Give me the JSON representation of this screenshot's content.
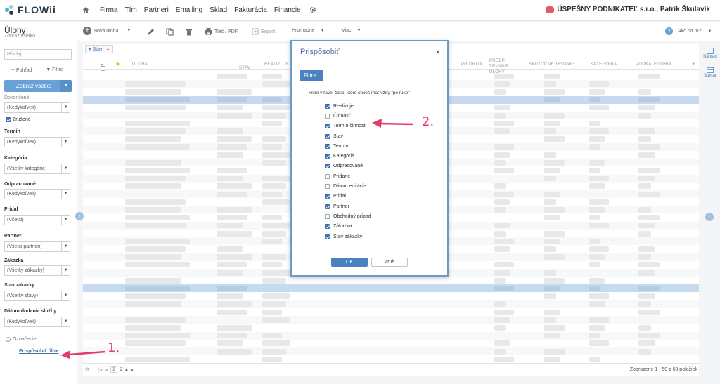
{
  "app": {
    "logo_text": "FLOWii"
  },
  "nav": {
    "items": [
      "Firma",
      "Tím",
      "Partneri",
      "Emailing",
      "Sklad",
      "Fakturácia",
      "Financie"
    ]
  },
  "company": {
    "label": "ÚSPEŠNÝ PODNIKATEĽ s.r.o., Patrik Škulavík"
  },
  "sidebar": {
    "title": "Úlohy",
    "subtitle": "Zobraz všetko",
    "search_placeholder": "Hľadaj...",
    "tab_view": "Pohľad",
    "tab_filters": "Filtre",
    "primary_button": "Zobraz všetko",
    "filters": [
      {
        "label": "Dokončené",
        "value": "(Kedykoľvek)"
      },
      {
        "label": "Termín",
        "value": "(Kedykoľvek)"
      },
      {
        "label": "Kategória",
        "value": "(Všetky kategórie)"
      },
      {
        "label": "Odpracované",
        "value": "(Kedykoľvek)"
      },
      {
        "label": "Pridal",
        "value": "(Všetci)"
      },
      {
        "label": "Partner",
        "value": "(Všetci partneri)"
      },
      {
        "label": "Zákazka",
        "value": "(Všetky zákazky)"
      },
      {
        "label": "Stav zákazky",
        "value": "(Všetky stavy)"
      },
      {
        "label": "Dátum dodania služby",
        "value": "(Kedykoľvek)"
      }
    ],
    "checkbox_zrusene": "Zrušené",
    "radio_oznacenie": "Označenie",
    "customize_link": "Prispôsobiť filtre"
  },
  "toolbar": {
    "new_task": "Nová úloha",
    "print": "Tlač / PDF",
    "export": "Export",
    "bulk": "Hromadne",
    "more": "Viac",
    "help": "Ako na to?"
  },
  "grid": {
    "tag": "Stav",
    "columns": [
      "ÚLOHA",
      "STAV",
      "REALIZUJE",
      "PRIORITA",
      "PREDP. TRVANIE ÚLOHY",
      "SKUTOČNÉ TRVANIE",
      "KATEGÓRIA",
      "PODKATEGÓRIA"
    ],
    "pages": [
      "1",
      "2"
    ],
    "summary": "Zobrazené 1 - 50 z 60 položiek"
  },
  "rail": {
    "preview": "Náhľad",
    "summary": "Sumár"
  },
  "modal": {
    "title": "Prispôsobiť",
    "close": "×",
    "tab": "Filtre",
    "description": "Filtre v ľavej časti, ktoré chceš mať vždy \"po ruke\"",
    "options": [
      {
        "label": "Realizuje",
        "checked": true
      },
      {
        "label": "Činnosť",
        "checked": false
      },
      {
        "label": "Termín činnosti",
        "checked": true
      },
      {
        "label": "Stav",
        "checked": true
      },
      {
        "label": "Termín",
        "checked": true
      },
      {
        "label": "Kategória",
        "checked": true
      },
      {
        "label": "Odpracované",
        "checked": true
      },
      {
        "label": "Pridané",
        "checked": false
      },
      {
        "label": "Dátum editácie",
        "checked": false
      },
      {
        "label": "Pridal",
        "checked": true
      },
      {
        "label": "Partner",
        "checked": true
      },
      {
        "label": "Obchodný prípad",
        "checked": false
      },
      {
        "label": "Zákazka",
        "checked": true
      },
      {
        "label": "Stav zákazky",
        "checked": true
      }
    ],
    "ok": "OK",
    "cancel": "Zruš"
  },
  "annotations": {
    "one": "1.",
    "two": "2."
  },
  "colors": {
    "accent": "#4a82c0",
    "annotation": "#e23d6a",
    "brand_teal": "#46b8c5"
  }
}
